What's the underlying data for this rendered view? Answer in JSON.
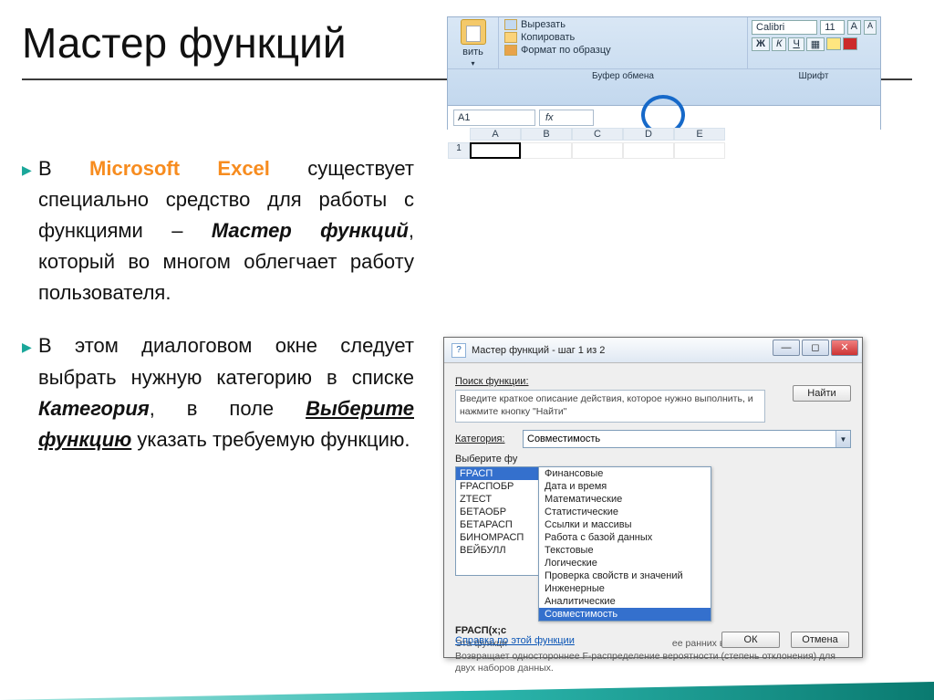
{
  "slide": {
    "title": "Мастер функций",
    "bullets": [
      {
        "pre": "В ",
        "brand": "Microsoft Excel",
        "post1": " существует специально средство для работы с функциями – ",
        "term": "Мастер функций",
        "post2": ", который во многом облегчает работу пользователя."
      },
      {
        "pre": "В этом диалоговом окне следует выбрать нужную категорию в списке ",
        "term1": "Категория",
        "mid": ", в поле ",
        "term2": "Выберите функцию",
        "post": " указать требуемую функцию."
      }
    ]
  },
  "ribbon": {
    "paste": "вить",
    "paste_drop": "▾",
    "cut": "Вырезать",
    "copy": "Копировать",
    "format_painter": "Формат по образцу",
    "group_clipboard": "Буфер обмена",
    "font_name": "Calibri",
    "font_size": "11",
    "bold": "Ж",
    "italic": "К",
    "underline": "Ч",
    "group_font": "Шрифт"
  },
  "sheet": {
    "namebox": "A1",
    "fx": "fx",
    "cols": [
      "A",
      "B",
      "C",
      "D",
      "E"
    ],
    "row1": "1"
  },
  "dialog": {
    "title": "Мастер функций - шаг 1 из 2",
    "search_label": "Поиск функции:",
    "search_text": "Введите краткое описание действия, которое нужно выполнить, и нажмите кнопку \"Найти\"",
    "find_btn": "Найти",
    "category_label": "Категория:",
    "category_value": "Совместимость",
    "select_label": "Выберите фу",
    "functions": [
      "FРАСП",
      "FРАСПОБР",
      "ZТЕСТ",
      "БЕТАОБР",
      "БЕТАРАСП",
      "БИНОМРАСП",
      "ВЕЙБУЛЛ"
    ],
    "categories": [
      "Финансовые",
      "Дата и время",
      "Математические",
      "Статистические",
      "Ссылки и массивы",
      "Работа с базой данных",
      "Текстовые",
      "Логические",
      "Проверка свойств и значений",
      "Инженерные",
      "Аналитические",
      "Совместимость"
    ],
    "signature": "FРАСП(x;с",
    "desc_line1": "Эта функци",
    "desc_tail": "ее ранних версий.",
    "desc_line2": "Возвращает одностороннее F-распределение вероятности (степень отклонения) для двух наборов данных.",
    "help": "Справка по этой функции",
    "ok": "ОК",
    "cancel": "Отмена"
  }
}
